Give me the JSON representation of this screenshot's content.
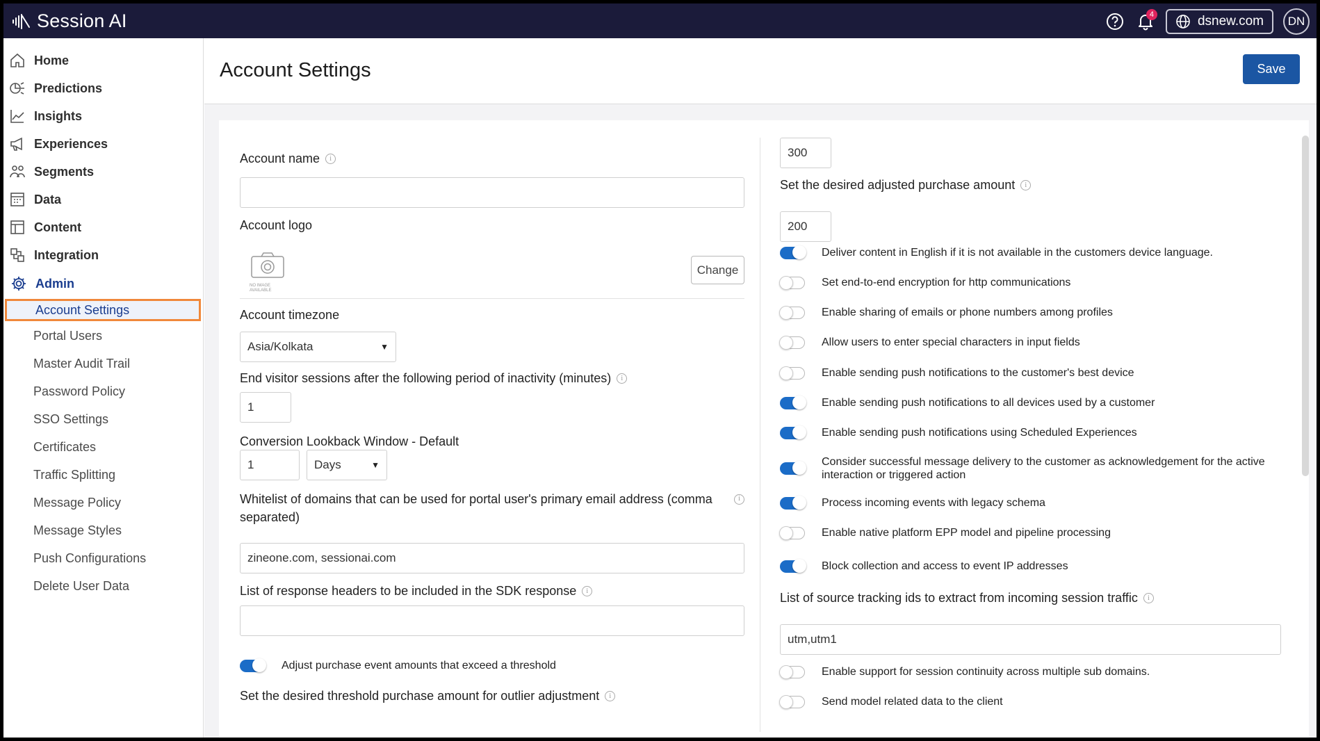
{
  "app": {
    "name": "Session AI"
  },
  "header": {
    "notifications_count": "4",
    "domain": "dsnew.com",
    "avatar_initials": "DN"
  },
  "sidebar": {
    "nav": [
      {
        "label": "Home",
        "icon": "home-icon"
      },
      {
        "label": "Predictions",
        "icon": "predictions-icon"
      },
      {
        "label": "Insights",
        "icon": "insights-icon"
      },
      {
        "label": "Experiences",
        "icon": "megaphone-icon"
      },
      {
        "label": "Segments",
        "icon": "segments-icon"
      },
      {
        "label": "Data",
        "icon": "data-icon"
      },
      {
        "label": "Content",
        "icon": "content-icon"
      },
      {
        "label": "Integration",
        "icon": "integration-icon"
      },
      {
        "label": "Admin",
        "icon": "gear-icon"
      }
    ],
    "admin_items": [
      "Account Settings",
      "Portal Users",
      "Master Audit Trail",
      "Password Policy",
      "SSO Settings",
      "Certificates",
      "Traffic Splitting",
      "Message Policy",
      "Message Styles",
      "Push Configurations",
      "Delete User Data"
    ],
    "active_item": "Account Settings"
  },
  "page": {
    "title": "Account Settings",
    "save_label": "Save"
  },
  "form": {
    "account_name_label": "Account name",
    "account_name_value": "",
    "account_logo_label": "Account logo",
    "logo_placeholder_text": "NO IMAGE AVAILABLE",
    "change_label": "Change",
    "timezone_label": "Account timezone",
    "timezone_value": "Asia/Kolkata",
    "inactivity_label": "End visitor sessions after the following period of inactivity (minutes)",
    "inactivity_value": "1",
    "lookback_label": "Conversion Lookback Window - Default",
    "lookback_value": "1",
    "lookback_unit": "Days",
    "whitelist_label_1": "Whitelist of domains that can be used for portal user's primary email address (comma",
    "whitelist_label_2": "separated)",
    "whitelist_value": "zineone.com, sessionai.com",
    "headers_label": "List of response headers to be included in the SDK response",
    "headers_value": "",
    "adjust_purchase_label": "Adjust purchase event amounts that exceed a threshold",
    "adjust_purchase_on": true,
    "threshold_label": "Set the desired threshold purchase amount for outlier adjustment",
    "threshold_value": "300",
    "adjusted_amount_label": "Set the desired adjusted purchase amount",
    "adjusted_amount_value": "200",
    "toggles": [
      {
        "label": "Deliver content in English if it is not available in the customers device language.",
        "on": true
      },
      {
        "label": "Set end-to-end encryption for http communications",
        "on": false
      },
      {
        "label": "Enable sharing of emails or phone numbers among profiles",
        "on": false
      },
      {
        "label": "Allow users to enter special characters in input fields",
        "on": false
      },
      {
        "label": "Enable sending push notifications to the customer's best device",
        "on": false
      },
      {
        "label": "Enable sending push notifications to all devices used by a customer",
        "on": true
      },
      {
        "label": "Enable sending push notifications using Scheduled Experiences",
        "on": true
      },
      {
        "label": "Consider successful message delivery to the customer as acknowledgement for the active",
        "label2": "interaction or triggered action",
        "on": true
      },
      {
        "label": "Process incoming events with legacy schema",
        "on": true
      },
      {
        "label": "Enable native platform EPP model and pipeline processing",
        "on": false
      },
      {
        "label": "Block collection and access to event IP addresses",
        "on": true
      }
    ],
    "source_ids_label": "List of source tracking ids to extract from incoming session traffic",
    "source_ids_value": "utm,utm1",
    "bottom_toggles": [
      {
        "label": "Enable support for session continuity across multiple sub domains.",
        "on": false
      },
      {
        "label": "Send model related data to the client",
        "on": false
      }
    ]
  }
}
